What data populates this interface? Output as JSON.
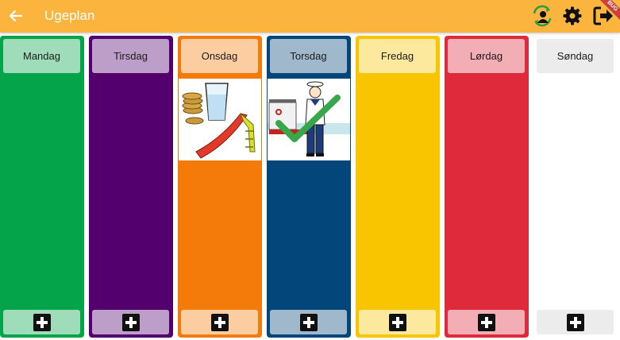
{
  "appbar": {
    "title": "Ugeplan",
    "back_icon": "arrow-left-icon",
    "actions": [
      "switch-user-icon",
      "gear-icon",
      "logout-icon"
    ],
    "debug_ribbon": "BUG",
    "color": "#fbb43e"
  },
  "days": [
    {
      "name": "Mandag",
      "color": "#04a54a"
    },
    {
      "name": "Tirsdag",
      "color": "#53006e"
    },
    {
      "name": "Onsdag",
      "color": "#f47b09"
    },
    {
      "name": "Torsdag",
      "color": "#03467a"
    },
    {
      "name": "Fredag",
      "color": "#f8c500"
    },
    {
      "name": "Lørdag",
      "color": "#de2a3a"
    },
    {
      "name": "Søndag",
      "color": "#ffffff"
    }
  ],
  "activities": {
    "onsdag": {
      "icons": [
        "coins-icon",
        "glass-of-water-icon",
        "slide-icon"
      ]
    },
    "torsdag": {
      "icons": [
        "sailor-icon",
        "boat-icon",
        "checkmark-icon"
      ],
      "completed": true
    }
  },
  "add_icon": "plus-icon"
}
